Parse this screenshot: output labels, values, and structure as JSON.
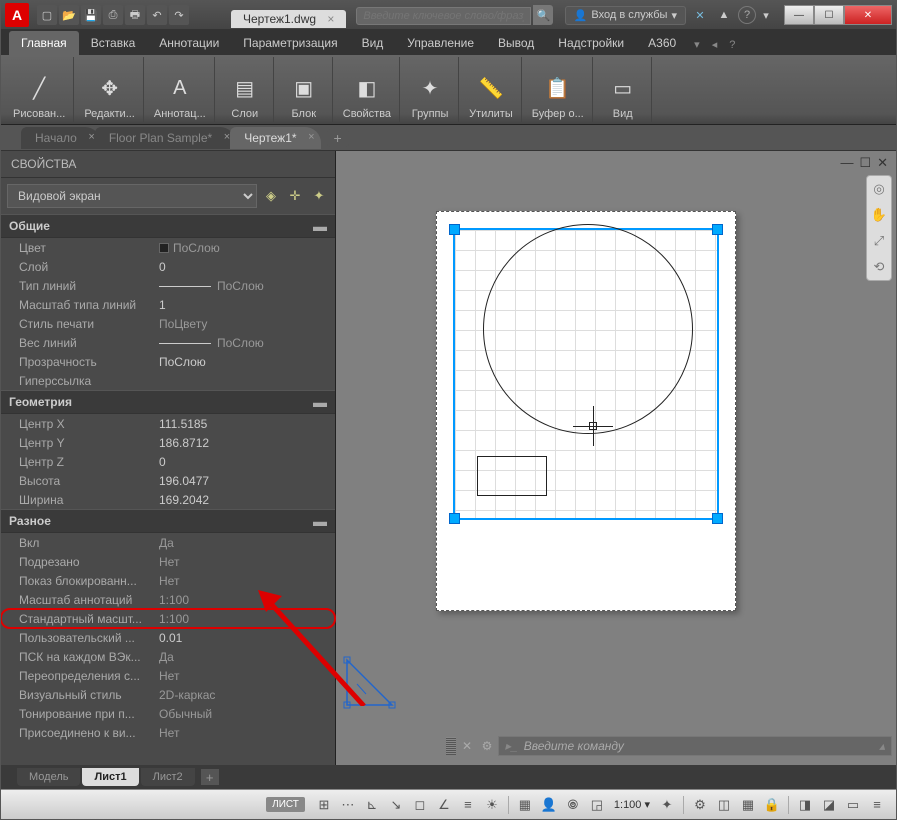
{
  "titlebar": {
    "doc_title": "Чертеж1.dwg",
    "search_placeholder": "Введите ключевое слово/фразу",
    "login_label": "Вход в службы"
  },
  "ribbon_tabs": [
    "Главная",
    "Вставка",
    "Аннотации",
    "Параметризация",
    "Вид",
    "Управление",
    "Вывод",
    "Надстройки",
    "A360"
  ],
  "ribbon_active": 0,
  "panels": [
    {
      "name": "draw",
      "label": "Рисован...",
      "icon": "╱"
    },
    {
      "name": "edit",
      "label": "Редакти...",
      "icon": "✥"
    },
    {
      "name": "annotate",
      "label": "Аннотац...",
      "icon": "A"
    },
    {
      "name": "layers",
      "label": "Слои",
      "icon": "▤"
    },
    {
      "name": "block",
      "label": "Блок",
      "icon": "▣"
    },
    {
      "name": "properties",
      "label": "Свойства",
      "icon": "◧"
    },
    {
      "name": "groups",
      "label": "Группы",
      "icon": "✦"
    },
    {
      "name": "utilities",
      "label": "Утилиты",
      "icon": "📏"
    },
    {
      "name": "clipboard",
      "label": "Буфер о...",
      "icon": "📋"
    },
    {
      "name": "view",
      "label": "Вид",
      "icon": "▭"
    }
  ],
  "doc_tabs": [
    {
      "label": "Начало",
      "active": false,
      "modified": false
    },
    {
      "label": "Floor Plan Sample*",
      "active": false,
      "modified": true
    },
    {
      "label": "Чертеж1*",
      "active": true,
      "modified": true
    }
  ],
  "properties": {
    "title": "СВОЙСТВА",
    "selector": "Видовой экран",
    "sections": [
      {
        "name": "Общие",
        "rows": [
          {
            "label": "Цвет",
            "value": "ПоСлою",
            "type": "color"
          },
          {
            "label": "Слой",
            "value": "0",
            "editable": true
          },
          {
            "label": "Тип линий",
            "value": "ПоСлою",
            "type": "linetype"
          },
          {
            "label": "Масштаб типа линий",
            "value": "1",
            "editable": true
          },
          {
            "label": "Стиль печати",
            "value": "ПоЦвету"
          },
          {
            "label": "Вес линий",
            "value": "ПоСлою",
            "type": "linetype"
          },
          {
            "label": "Прозрачность",
            "value": "ПоСлою",
            "editable": true
          },
          {
            "label": "Гиперссылка",
            "value": ""
          }
        ]
      },
      {
        "name": "Геометрия",
        "rows": [
          {
            "label": "Центр X",
            "value": "111.5185",
            "editable": true
          },
          {
            "label": "Центр Y",
            "value": "186.8712",
            "editable": true
          },
          {
            "label": "Центр Z",
            "value": "0",
            "editable": true
          },
          {
            "label": "Высота",
            "value": "196.0477",
            "editable": true
          },
          {
            "label": "Ширина",
            "value": "169.2042",
            "editable": true
          }
        ]
      },
      {
        "name": "Разное",
        "rows": [
          {
            "label": "Вкл",
            "value": "Да"
          },
          {
            "label": "Подрезано",
            "value": "Нет"
          },
          {
            "label": "Показ блокированн...",
            "value": "Нет"
          },
          {
            "label": "Масштаб аннотаций",
            "value": "1:100"
          },
          {
            "label": "Стандартный масшт...",
            "value": "1:100",
            "highlight": true
          },
          {
            "label": "Пользовательский ...",
            "value": "0.01",
            "editable": true
          },
          {
            "label": "ПСК на каждом ВЭк...",
            "value": "Да"
          },
          {
            "label": "Переопределения с...",
            "value": "Нет"
          },
          {
            "label": "Визуальный стиль",
            "value": "2D-каркас"
          },
          {
            "label": "Тонирование при п...",
            "value": "Обычный"
          },
          {
            "label": "Присоединено к ви...",
            "value": "Нет"
          }
        ]
      }
    ]
  },
  "command_placeholder": "Введите команду",
  "layout_tabs": [
    {
      "label": "Модель",
      "active": false
    },
    {
      "label": "Лист1",
      "active": true
    },
    {
      "label": "Лист2",
      "active": false
    }
  ],
  "statusbar": {
    "mode_label": "ЛИСТ",
    "scale": "1:100"
  }
}
